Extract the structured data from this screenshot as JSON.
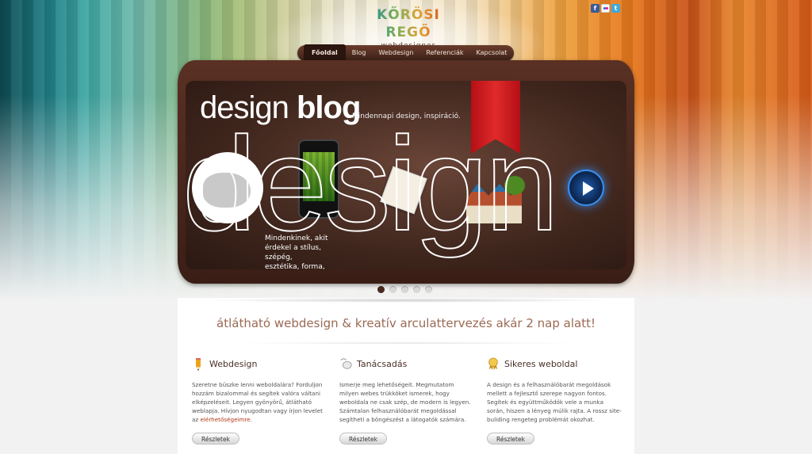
{
  "logo": {
    "name": "KŐRÖSI REGŐ",
    "sub": "webdesigner"
  },
  "social": {
    "facebook": "f",
    "flickr": "flickr-icon",
    "twitter": "t"
  },
  "nav": {
    "items": [
      "Főoldal",
      "Blog",
      "Webdesign",
      "Referenciák",
      "Kapcsolat"
    ],
    "active": "Főoldal"
  },
  "banner": {
    "title_light": "design",
    "title_bold": "blog",
    "tagline": "Mindennapi design, inspiráció.",
    "big_word": "design",
    "text": "Mindenkinek, akit érdekel a stílus, szépég, esztétika, forma, harmónia.",
    "slides": 5,
    "active_slide": 1
  },
  "slogan": "átlátható webdesign & kreatív arculattervezés akár 2 nap alatt!",
  "columns": [
    {
      "icon": "pencil-icon",
      "title": "Webdesign",
      "text": "Szeretne büszke lenni weboldalára? Forduljon hozzám bizalommal és segítek valóra váltani elképzeléseit. Legyen gyönyörű, átlátható weblapja. Hívjon nyugodtan vagy írjon levelet az",
      "link": "elérhetőségeimre",
      "after_link": ".",
      "button": "Részletek"
    },
    {
      "icon": "mouse-icon",
      "title": "Tanácsadás",
      "text": "Ismerje meg lehetőségeit. Megmutatom milyen webes trükköket ismerek, hogy weboldala ne csak szép, de modern is legyen. Számtalan felhasználóbarát megoldással segítheti a böngészést a látogatók számára.",
      "button": "Részletek"
    },
    {
      "icon": "award-icon",
      "title": "Sikeres weboldal",
      "text": "A design és a felhasználóbarát megoldások mellett a fejlesztő szerepe nagyon fontos. Segítek és együttműködök vele a munka során, hiszen a lényeg múlik rajta. A rossz site-buliding rengeteg problémát okozhat.",
      "button": "Részletek"
    }
  ],
  "colors": {
    "brown": "#4a2a20",
    "accent": "#9b6a54",
    "link": "#b03a1a"
  }
}
